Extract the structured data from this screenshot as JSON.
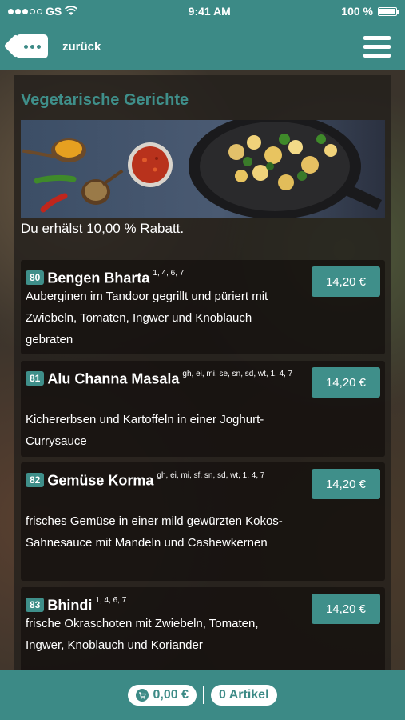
{
  "status_bar": {
    "carrier": "GS",
    "time": "9:41 AM",
    "battery": "100 %",
    "battery_level": 1.0
  },
  "header": {
    "back_label": "zurück"
  },
  "section": {
    "title": "Vegetarische Gerichte",
    "discount_text": "Du erhälst 10,00 % Rabatt."
  },
  "items": [
    {
      "number": "80",
      "name": "Bengen Bharta",
      "allergens": "1, 4, 6, 7",
      "description": "Auberginen im Tandoor gegrillt und püriert mit Zwiebeln, Tomaten, Ingwer und Knoblauch gebraten",
      "price": "14,20 €"
    },
    {
      "number": "81",
      "name": "Alu Channa Masala",
      "allergens": "gh, ei, mi, se, sn, sd, wt, 1, 4, 7",
      "description": "Kichererbsen und Kartoffeln in einer Joghurt-Currysauce",
      "price": "14,20 €"
    },
    {
      "number": "82",
      "name": "Gemüse Korma",
      "allergens": "gh, ei, mi, sf, sn, sd, wt, 1, 4, 7",
      "description": "frisches Gemüse in einer mild gewürzten Kokos-Sahnesauce mit Mandeln und Cashewkernen",
      "price": "14,20 €"
    },
    {
      "number": "83",
      "name": "Bhindi",
      "allergens": "1, 4, 6, 7",
      "description": "frische Okraschoten mit Zwiebeln, Tomaten, Ingwer, Knoblauch und Koriander",
      "price": "14,20 €"
    }
  ],
  "footer": {
    "cart_total": "0,00 €",
    "article_count": "0 Artikel"
  },
  "colors": {
    "accent": "#3c8a86",
    "title": "#3f8f8a"
  }
}
